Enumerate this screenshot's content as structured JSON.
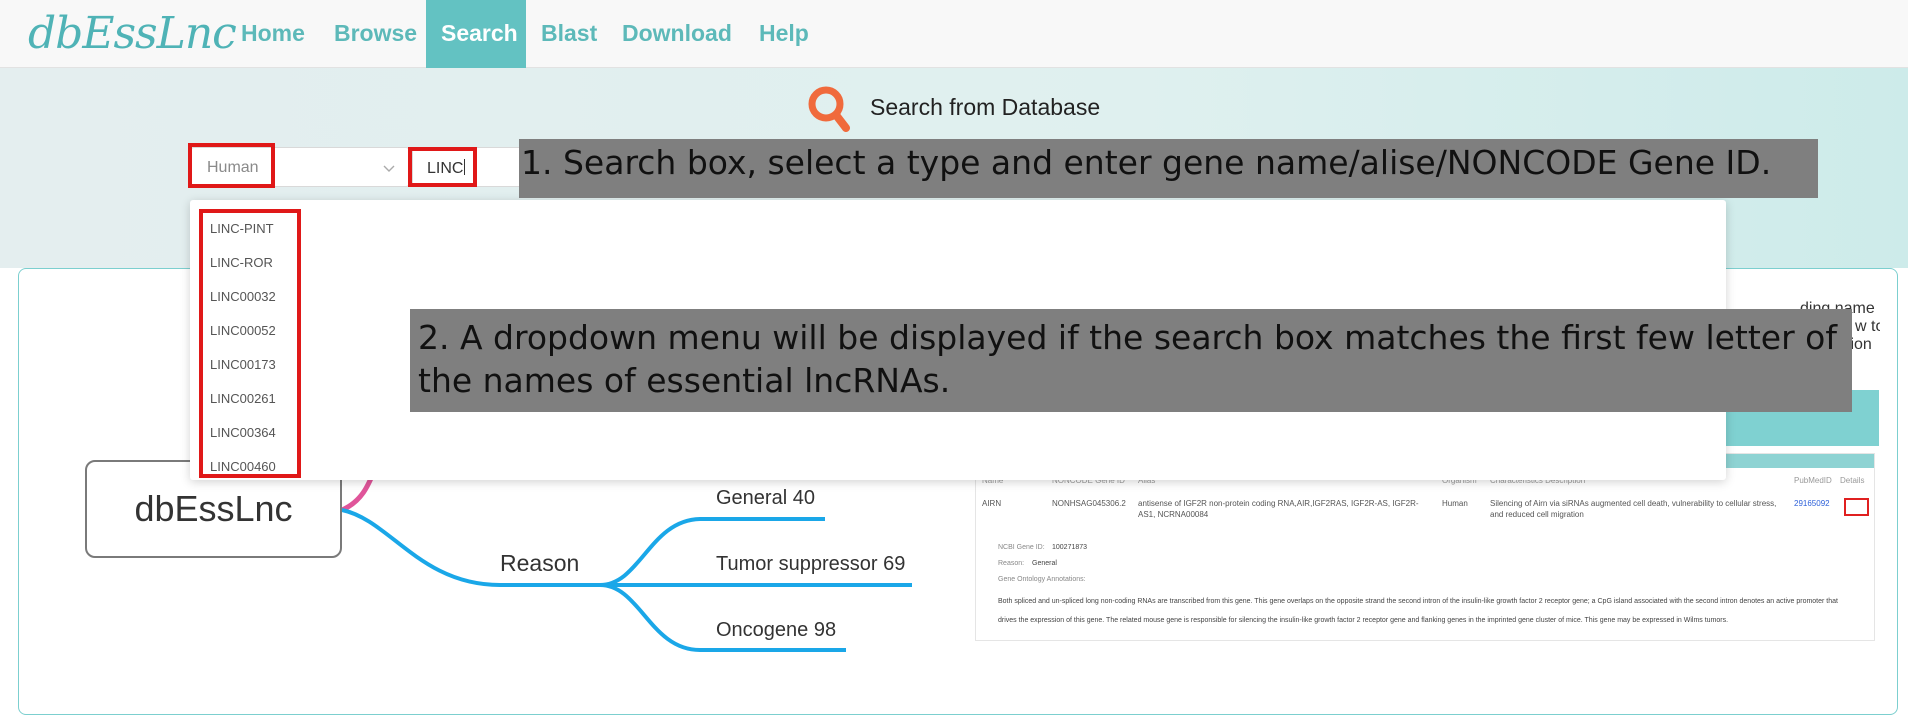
{
  "app": {
    "logo": "dbEssLnc",
    "brand_color": "#4fb3b6"
  },
  "nav": {
    "items": [
      {
        "label": "Home"
      },
      {
        "label": "Browse"
      },
      {
        "label": "Search"
      },
      {
        "label": "Blast"
      },
      {
        "label": "Download"
      },
      {
        "label": "Help"
      }
    ],
    "active": "Search"
  },
  "search": {
    "title": "Search from Database",
    "type_select_value": "Human",
    "query_value": "LINC",
    "icon": "search-icon"
  },
  "dropdown": {
    "items": [
      "LINC-PINT",
      "LINC-ROR",
      "LINC00032",
      "LINC00052",
      "LINC00173",
      "LINC00261",
      "LINC00364",
      "LINC00460"
    ]
  },
  "mindmap": {
    "root": "dbEssLnc",
    "branch": "Reason",
    "leaves": [
      "General 40",
      "Tumor suppressor 69",
      "Oncogene 98"
    ]
  },
  "right_panel": {
    "truncated_lines": [
      "ding name If you want",
      "w to",
      "ction"
    ],
    "table": {
      "headers": [
        "Name",
        "NONCODE Gene ID",
        "Alias",
        "Organism",
        "Characteristics Description",
        "PubMedID",
        "Details"
      ],
      "row": {
        "name": "AIRN",
        "gene_id": "NONHSAG045306.2",
        "alias": "antisense of IGF2R non-protein coding RNA,AIR,IGF2RAS, IGF2R-AS, IGF2R-AS1, NCRNA00084",
        "organism": "Human",
        "description": "Silencing of Airn via siRNAs augmented cell death, vulnerability to cellular stress, and reduced cell migration",
        "pubmed": "29165092"
      },
      "details": {
        "ncbi_label": "NCBI Gene ID:",
        "ncbi_value": "100271873",
        "reason_label": "Reason:",
        "reason_value": "General",
        "go_label": "Gene Ontology Annotations:",
        "summary": "Both spliced and un-spliced long non-coding RNAs are transcribed from this gene. This gene overlaps on the opposite strand the second intron of the insulin-like growth factor 2 receptor gene; a CpG island associated with the second intron denotes an active promoter that drives the expression of this gene. The related mouse gene is responsible for silencing the insulin-like growth factor 2 receptor gene and flanking genes in the imprinted gene cluster of mice. This gene may be expressed in Wilms tumors."
      }
    }
  },
  "annotations": {
    "step1": "1. Search box, select a type and enter gene name/alise/NONCODE Gene ID.",
    "step2": "2. A dropdown menu will be displayed if the search box matches the first few letter of the names of essential lncRNAs."
  },
  "colors": {
    "nav_active": "#63c2c2",
    "highlight": "#e01818",
    "annotation_bg": "#7f7f7f",
    "mindmap_line": "#1aa7e8",
    "mindmap_pink": "#e0559a"
  }
}
